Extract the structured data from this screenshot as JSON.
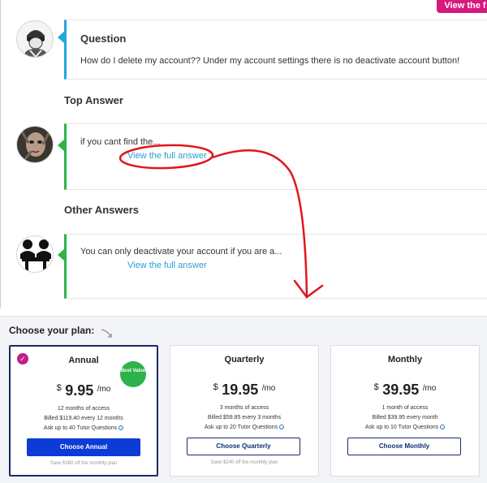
{
  "header": {
    "cta_label": "View the f"
  },
  "question": {
    "title": "Question",
    "text": "How do I delete my account?? Under my account settings there is no deactivate account button!"
  },
  "top_answer": {
    "section_title": "Top Answer",
    "text": "if you cant find the...",
    "link": "View the full answer"
  },
  "other_answers": {
    "section_title": "Other Answers",
    "items": [
      {
        "text": "You can only deactivate your account if you are a...",
        "link": "View the full answer"
      }
    ]
  },
  "plans": {
    "title": "Choose your plan:",
    "items": [
      {
        "name": "Annual",
        "currency": "$",
        "price": "9.95",
        "per": "/mo",
        "access": "12 months of access",
        "billing": "Billed $119.40 every 12 months",
        "questions": "Ask up to 40 Tutor Questions",
        "button": "Choose Annual",
        "save": "Save $360 off the monthly plan",
        "badge": "Best Value",
        "selected": true
      },
      {
        "name": "Quarterly",
        "currency": "$",
        "price": "19.95",
        "per": "/mo",
        "access": "3 months of access",
        "billing": "Billed $59.85 every 3 months",
        "questions": "Ask up to 20 Tutor Questions",
        "button": "Choose Quarterly",
        "save": "Save $240 off the monthly plan",
        "selected": false
      },
      {
        "name": "Monthly",
        "currency": "$",
        "price": "39.95",
        "per": "/mo",
        "access": "1 month of access",
        "billing": "Billed $39.95 every month",
        "questions": "Ask up to 10 Tutor Questions",
        "button": "Choose Monthly",
        "selected": false
      }
    ]
  },
  "colors": {
    "question_accent": "#23a7dc",
    "answer_accent": "#2db34a",
    "link": "#2a9fd1",
    "primary_button": "#0c3bd8",
    "badge": "#2db34a",
    "selected_check": "#c21d8c",
    "annotation": "#e0161b"
  },
  "icons": {
    "question_avatar": "user-avatar-icon",
    "top_answer_avatar": "user-avatar-icon",
    "other_answer_avatar": "user-avatar-icon",
    "selected": "check-icon",
    "info": "info-icon"
  }
}
